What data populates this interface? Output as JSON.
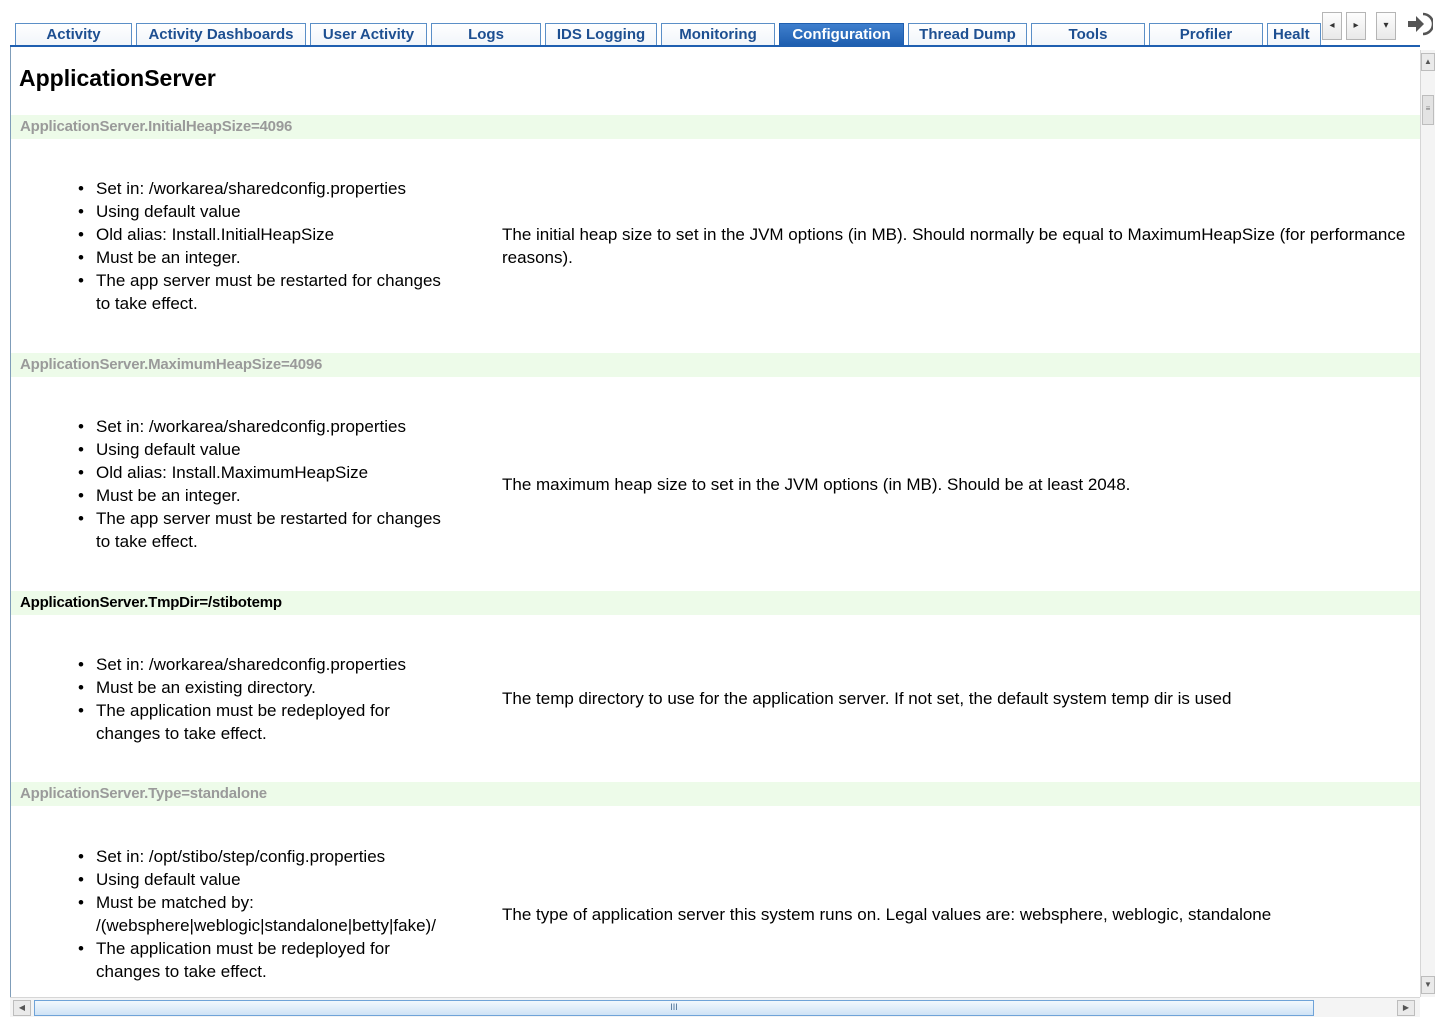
{
  "tabs": [
    {
      "label": "Activity",
      "active": false
    },
    {
      "label": "Activity Dashboards",
      "active": false
    },
    {
      "label": "User Activity",
      "active": false
    },
    {
      "label": "Logs",
      "active": false
    },
    {
      "label": "IDS Logging",
      "active": false
    },
    {
      "label": "Monitoring",
      "active": false
    },
    {
      "label": "Configuration",
      "active": true
    },
    {
      "label": "Thread Dump",
      "active": false
    },
    {
      "label": "Tools",
      "active": false
    },
    {
      "label": "Profiler",
      "active": false
    },
    {
      "label": "Healt",
      "active": false
    }
  ],
  "nav": {
    "prev_icon": "◂",
    "next_icon": "▸",
    "menu_icon": "▾"
  },
  "page": {
    "title": "ApplicationServer"
  },
  "properties": [
    {
      "header": "ApplicationServer.InitialHeapSize=4096",
      "bullets": [
        "Set in: /workarea/sharedconfig.properties",
        "Using default value",
        "Old alias: Install.InitialHeapSize",
        "Must be an integer.",
        "The app server must be restarted for changes to take effect."
      ],
      "description": "The initial heap size to set in the JVM options (in MB). Should normally be equal to MaximumHeapSize (for performance reasons)."
    },
    {
      "header": "ApplicationServer.MaximumHeapSize=4096",
      "bullets": [
        "Set in: /workarea/sharedconfig.properties",
        "Using default value",
        "Old alias: Install.MaximumHeapSize",
        "Must be an integer.",
        "The app server must be restarted for changes to take effect."
      ],
      "description": "The maximum heap size to set in the JVM options (in MB). Should be at least 2048."
    },
    {
      "header": "ApplicationServer.TmpDir=/stibotemp",
      "bullets": [
        "Set in: /workarea/sharedconfig.properties",
        "Must be an existing directory.",
        "The application must be redeployed for changes to take effect."
      ],
      "description": "The temp directory to use for the application server. If not set, the default system temp dir is used"
    },
    {
      "header": "ApplicationServer.Type=standalone",
      "bullets": [
        "Set in: /opt/stibo/step/config.properties",
        "Using default value",
        "Must be matched by: /(websphere|weblogic|standalone|betty|fake)/",
        "The application must be redeployed for changes to take effect."
      ],
      "description": "The type of application server this system runs on. Legal values are: websphere, weblogic, standalone"
    }
  ],
  "scrollbar": {
    "thumb_grip": "III"
  }
}
